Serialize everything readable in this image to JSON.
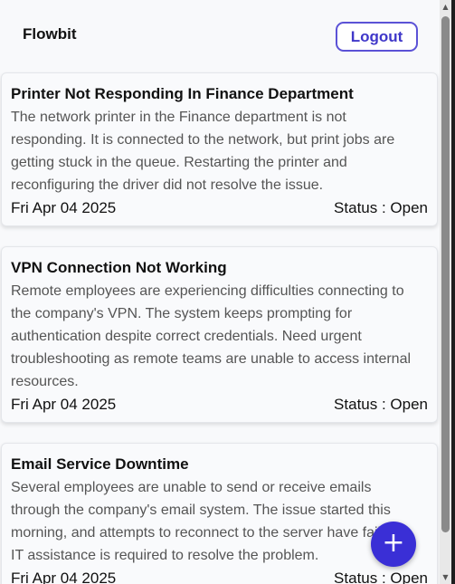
{
  "header": {
    "brand": "Flowbit",
    "logout_label": "Logout"
  },
  "tickets": [
    {
      "title": "Printer Not Responding In Finance Department",
      "description_lines": [
        "The network printer in the Finance department is not",
        "responding. It is connected to the network, but print jobs are",
        "getting stuck in the queue. Restarting the printer and",
        "reconfiguring the driver did not resolve the issue."
      ],
      "date": "Fri Apr 04 2025",
      "status": "Status : Open"
    },
    {
      "title": "VPN Connection Not Working",
      "description_lines": [
        "Remote employees are experiencing difficulties connecting to",
        "the company's VPN. The system keeps prompting for",
        "authentication despite correct credentials. Need urgent",
        "troubleshooting as remote teams are unable to access internal",
        "resources."
      ],
      "date": "Fri Apr 04 2025",
      "status": "Status : Open"
    },
    {
      "title": "Email Service Downtime",
      "description_lines": [
        "Several employees are unable to send or receive emails",
        "through the company's email system. The issue started this",
        "morning, and attempts to reconnect to the server have failed.",
        "IT assistance is required to resolve the problem."
      ],
      "date": "Fri Apr 04 2025",
      "status": "Status : Open"
    }
  ],
  "fab": {
    "icon": "plus-icon",
    "glyph": "+"
  },
  "colors": {
    "accent": "#3a2fd6",
    "logout_border": "#5b52d6",
    "background": "#f8f9fb"
  }
}
